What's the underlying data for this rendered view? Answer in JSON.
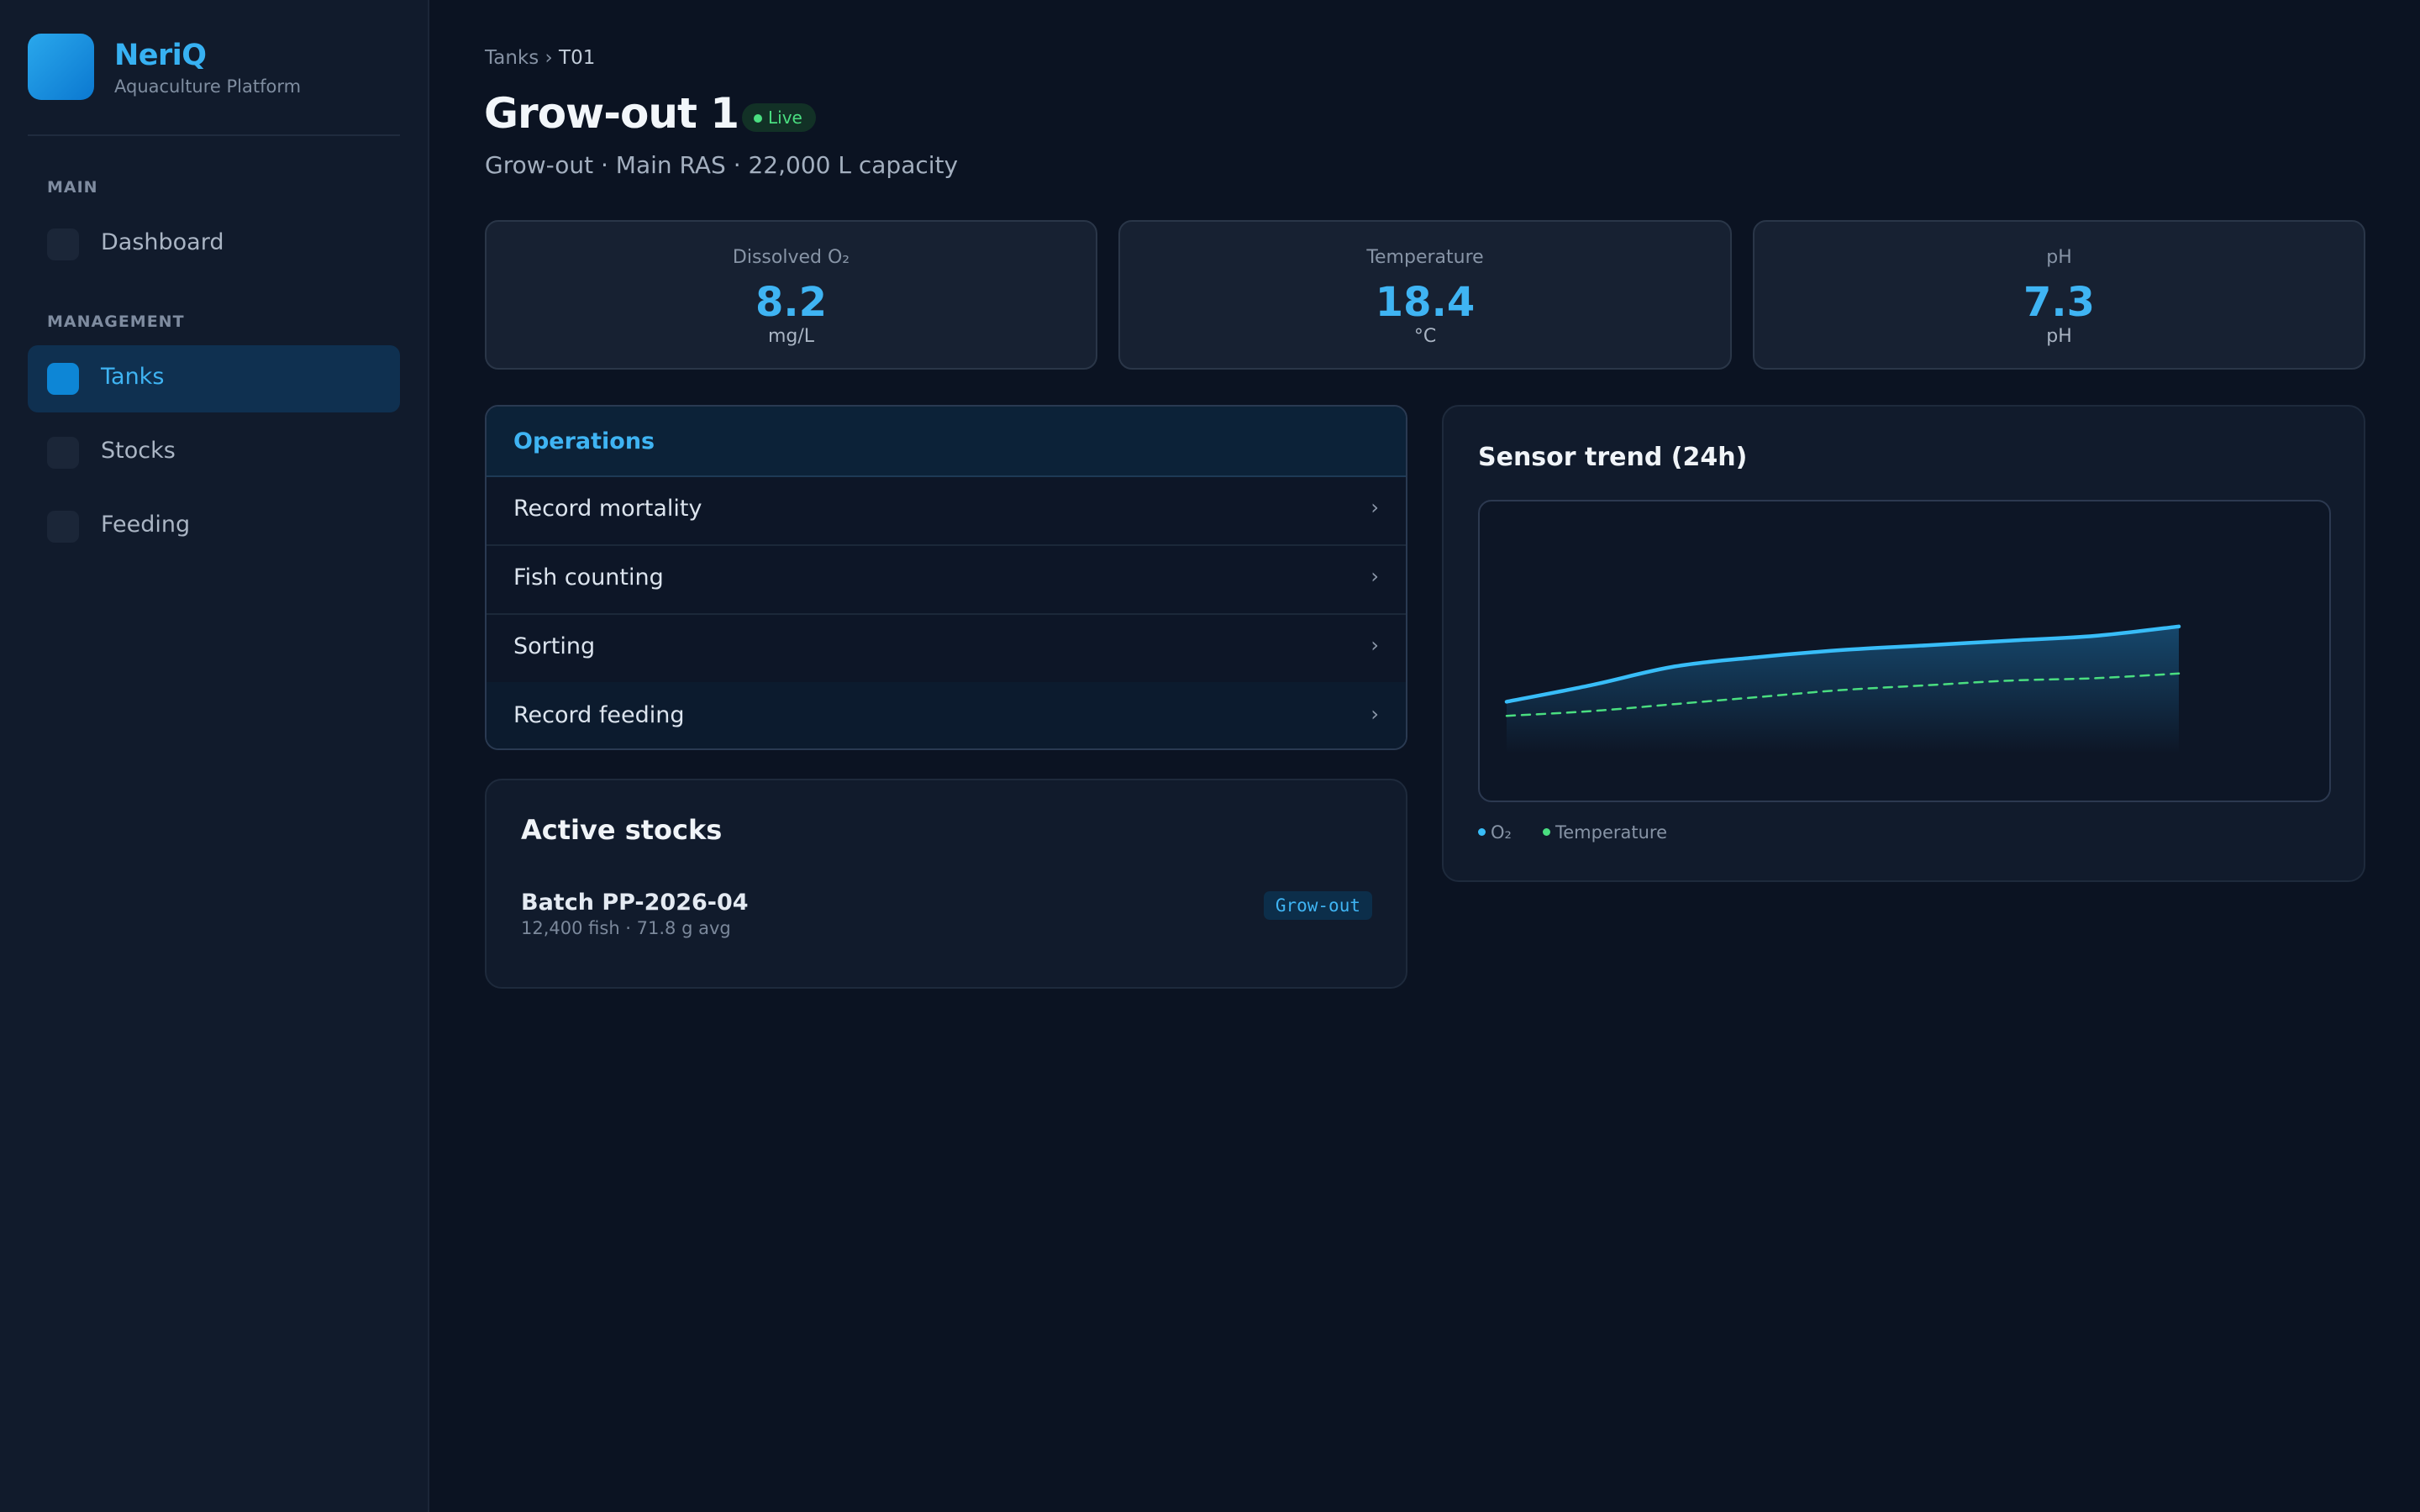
{
  "brand": {
    "name": "NeriQ",
    "subtitle": "Aquaculture Platform"
  },
  "sidebar": {
    "sections": [
      {
        "label": "MAIN",
        "items": [
          {
            "label": "Dashboard",
            "active": false
          }
        ]
      },
      {
        "label": "MANAGEMENT",
        "items": [
          {
            "label": "Tanks",
            "active": true
          },
          {
            "label": "Stocks",
            "active": false
          },
          {
            "label": "Feeding",
            "active": false
          }
        ]
      }
    ]
  },
  "breadcrumb": {
    "parent": "Tanks",
    "separator": "›",
    "current": "T01"
  },
  "page": {
    "title": "Grow-out 1",
    "status": "Live",
    "subtitle": "Grow-out · Main RAS · 22,000 L capacity"
  },
  "metrics": [
    {
      "label": "Dissolved O₂",
      "value": "8.2",
      "unit": "mg/L"
    },
    {
      "label": "Temperature",
      "value": "18.4",
      "unit": "°C"
    },
    {
      "label": "pH",
      "value": "7.3",
      "unit": "pH"
    }
  ],
  "operations": {
    "title": "Operations",
    "chevron": "›",
    "items": [
      "Record mortality",
      "Fish counting",
      "Sorting",
      "Record feeding"
    ]
  },
  "stocks": {
    "title": "Active stocks",
    "items": [
      {
        "name": "Batch PP-2026-04",
        "meta": "12,400 fish · 71.8 g avg",
        "tag": "Grow-out"
      }
    ]
  },
  "trend": {
    "title": "Sensor trend (24h)",
    "legend": [
      {
        "label": "O₂",
        "color": "#38bdf8"
      },
      {
        "label": "Temperature",
        "color": "#4ade80"
      }
    ]
  },
  "chart_data": {
    "type": "line",
    "title": "Sensor trend (24h)",
    "xlabel": "",
    "ylabel": "",
    "grid": false,
    "legend_position": "bottom-left",
    "x": [
      0,
      1,
      2,
      3,
      4,
      5,
      6,
      7,
      8
    ],
    "ylim": [
      0,
      10
    ],
    "series": [
      {
        "name": "O₂",
        "color": "#38bdf8",
        "style": "solid",
        "fill": true,
        "values": [
          2.2,
          2.9,
          3.7,
          4.1,
          4.4,
          4.6,
          4.8,
          5.0,
          5.4
        ]
      },
      {
        "name": "Temperature",
        "color": "#4ade80",
        "style": "dashed",
        "fill": false,
        "values": [
          1.6,
          1.8,
          2.1,
          2.4,
          2.7,
          2.9,
          3.1,
          3.2,
          3.4
        ]
      }
    ]
  },
  "colors": {
    "accent": "#3fb4f3",
    "live": "#4ade80",
    "background": "#0b1322",
    "sidebar": "#111b2c"
  }
}
